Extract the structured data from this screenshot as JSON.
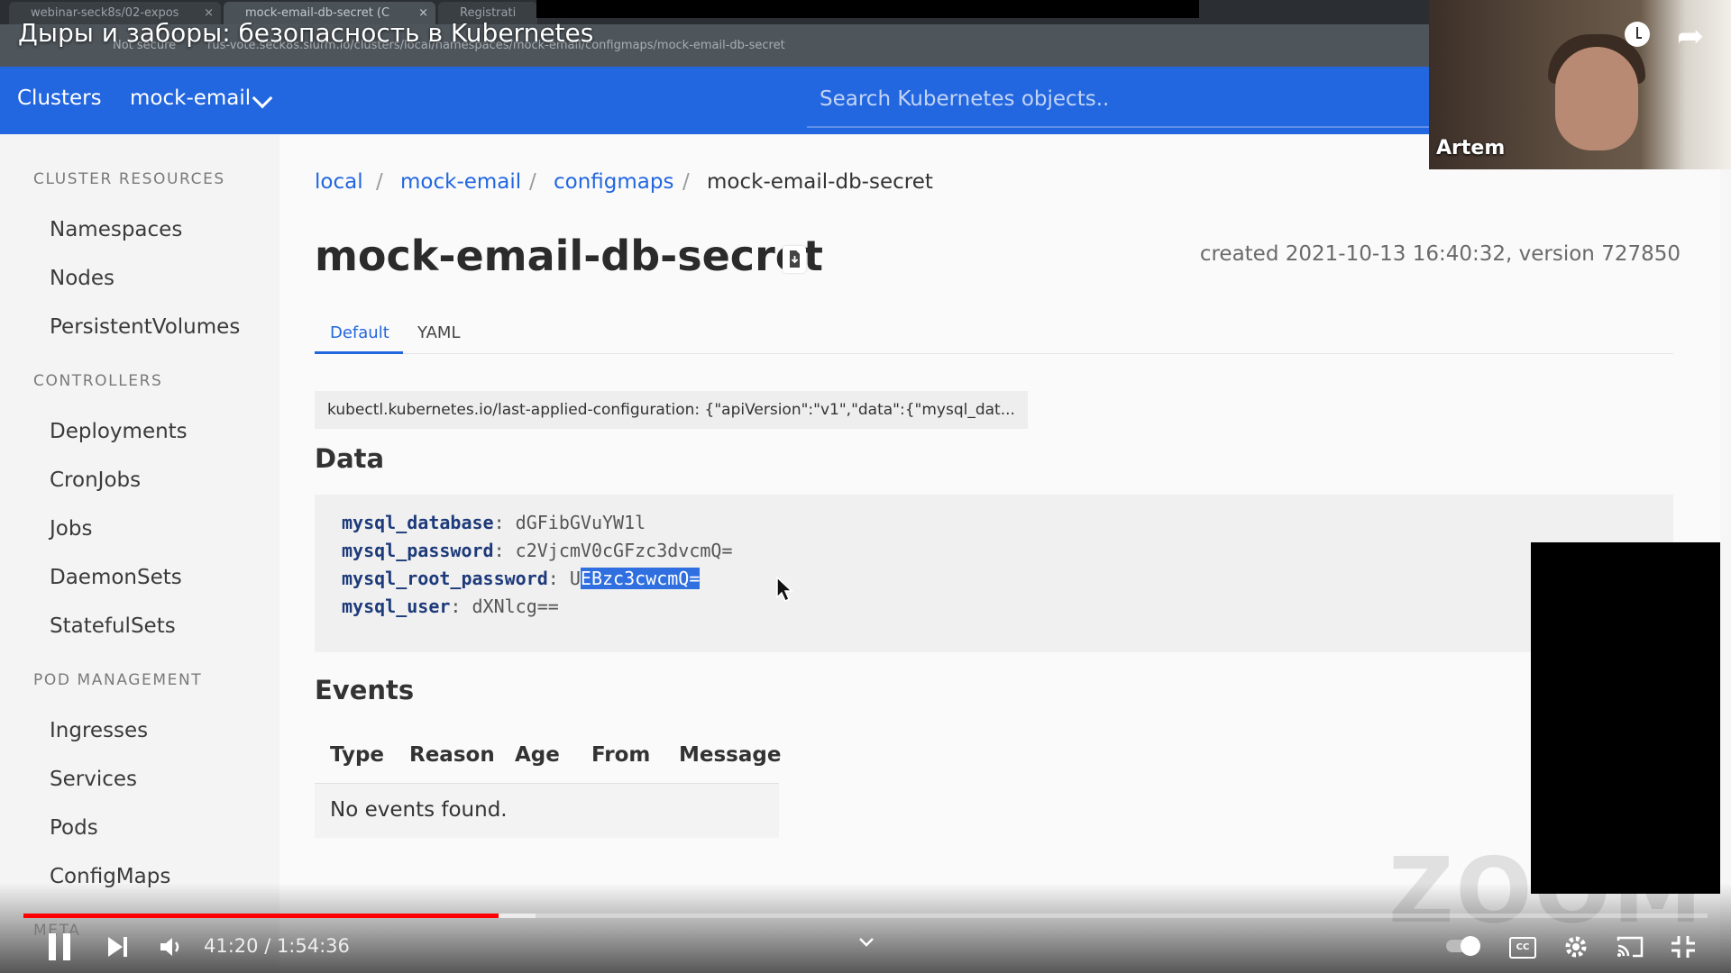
{
  "video": {
    "title": "Дыры и заборы: безопасность в Kubernetes",
    "time": "41:20 / 1:54:36",
    "progress_played": 0.282,
    "progress_buffered": 0.304,
    "presenter_name": "Artem",
    "watermark": "ZOOM"
  },
  "browser": {
    "tabs": [
      {
        "label": "webinar-seck8s/02-expos"
      },
      {
        "label": "mock-email-db-secret (C"
      },
      {
        "label": "Registrati"
      }
    ],
    "not_secure": "Not secure",
    "url": "rus-vote.seck8s.slurm.io/clusters/local/namespaces/mock-email/configmaps/mock-email-db-secret"
  },
  "header": {
    "clusters_label": "Clusters",
    "namespace": "mock-email",
    "search_placeholder": "Search Kubernetes objects.."
  },
  "sidebar": {
    "sections": [
      {
        "heading": "CLUSTER RESOURCES",
        "items": [
          "Namespaces",
          "Nodes",
          "PersistentVolumes"
        ]
      },
      {
        "heading": "CONTROLLERS",
        "items": [
          "Deployments",
          "CronJobs",
          "Jobs",
          "DaemonSets",
          "StatefulSets"
        ]
      },
      {
        "heading": "POD MANAGEMENT",
        "items": [
          "Ingresses",
          "Services",
          "Pods",
          "ConfigMaps"
        ]
      },
      {
        "heading": "META",
        "items": []
      }
    ]
  },
  "breadcrumb": [
    "local",
    "mock-email",
    "configmaps",
    "mock-email-db-secret"
  ],
  "page": {
    "title": "mock-email-db-secret",
    "created": "created 2021-10-13 16:40:32, version 727850",
    "tabs": [
      "Default",
      "YAML"
    ],
    "annotation": "kubectl.kubernetes.io/last-applied-configuration: {\"apiVersion\":\"v1\",\"data\":{\"mysql_dat...",
    "data_heading": "Data",
    "data": [
      {
        "key": "mysql_database",
        "value": "dGFibGVuYW1l"
      },
      {
        "key": "mysql_password",
        "value": "c2VjcmV0cGFzc3dvcmQ="
      },
      {
        "key": "mysql_root_password",
        "value_plain": "U",
        "value_selected": "EBzc3cwcmQ="
      },
      {
        "key": "mysql_user",
        "value": "dXNlcg=="
      }
    ],
    "events_heading": "Events",
    "events_columns": [
      "Type",
      "Reason",
      "Age",
      "From",
      "Message"
    ],
    "events_empty": "No events found."
  },
  "colors": {
    "accent": "#2266e0",
    "progress": "#ff0000"
  }
}
